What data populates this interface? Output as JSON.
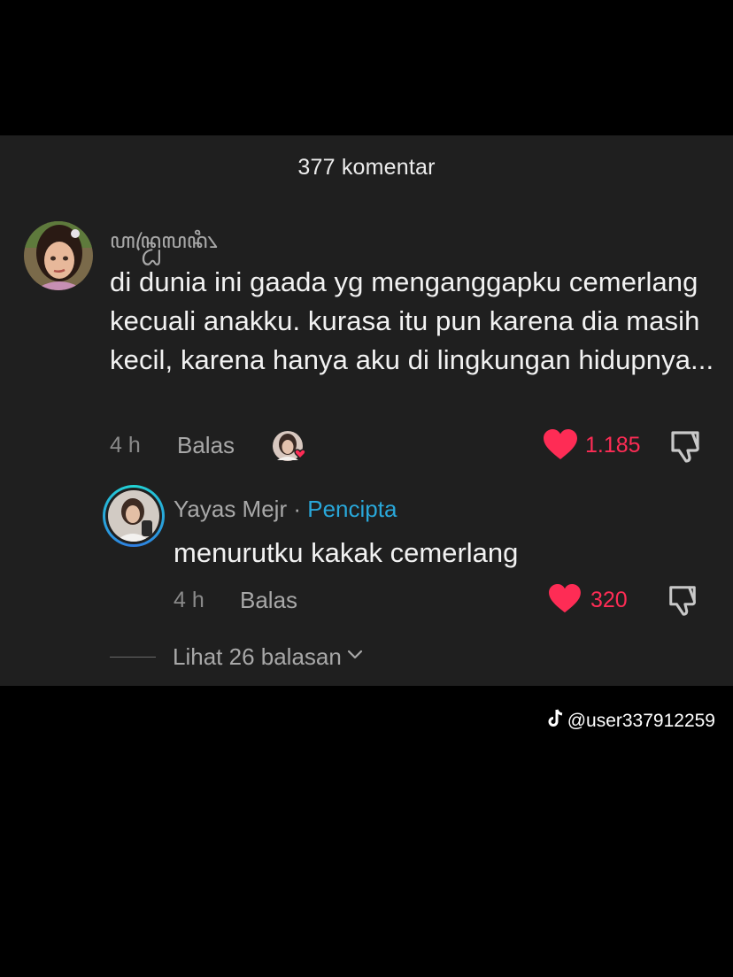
{
  "header": {
    "title": "377 komentar"
  },
  "comment": {
    "username": "ꦲꦤ꧀ꦝꦿꦭꦤꦶ꧈",
    "text": "di dunia ini gaada yg menganggapku cemerlang kecuali anakku. kurasa itu pun karena dia masih kecil, karena hanya aku di lingkungan hidupnya...",
    "time": "4 h",
    "reply_label": "Balas",
    "likes": "1.185",
    "liked_by_creator": true
  },
  "reply": {
    "author": "Yayas Mejr",
    "separator": "·",
    "badge": "Pencipta",
    "text": "menurutku kakak cemerlang",
    "time": "4 h",
    "reply_label": "Balas",
    "likes": "320"
  },
  "view_replies": {
    "label": "Lihat 26 balasan"
  },
  "watermark": {
    "handle": "@user337912259"
  },
  "colors": {
    "like": "#fe2c55",
    "creator_badge": "#29a7d9",
    "panel_bg": "#1f1f1f",
    "page_bg": "#000000"
  },
  "icons": [
    "heart-icon",
    "dislike-icon",
    "chevron-down-icon",
    "tiktok-logo-icon"
  ]
}
